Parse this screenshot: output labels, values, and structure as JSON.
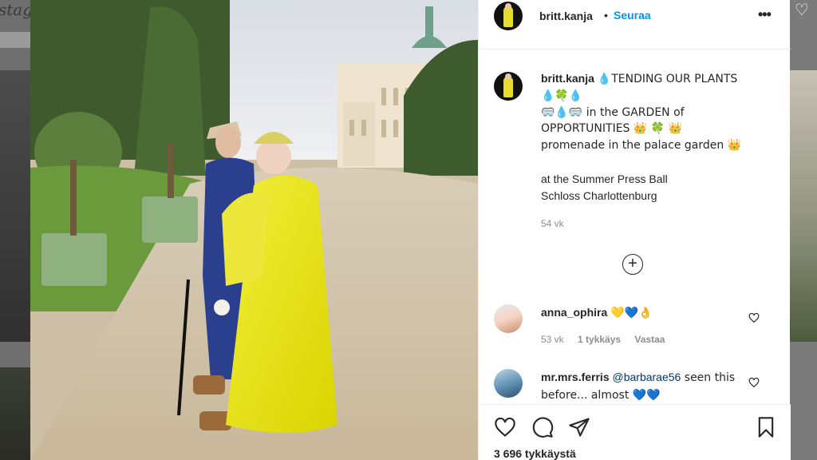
{
  "background": {
    "logo_fragment": "stagr"
  },
  "post": {
    "username": "britt.kanja",
    "dot": "•",
    "follow_label": "Seuraa",
    "more_icon": "more-horizontal-icon",
    "caption": {
      "line1": "💧TENDING OUR PLANTS",
      "line2": "💧🍀💧",
      "line3": "🥽💧🥽 in the GARDEN of",
      "line4": "OPPORTUNITIES 👑 🍀 👑",
      "line5": "promenade in the palace garden 👑",
      "line6": "",
      "line7": "at the Summer Press Ball",
      "line8": "Schloss Charlottenburg"
    },
    "caption_time": "54 vk",
    "load_more_icon": "plus-circle-icon",
    "comments": [
      {
        "username": "anna_ophira",
        "text": "💛💙👌",
        "time": "53 vk",
        "likes": "1 tykkäys",
        "reply": "Vastaa"
      },
      {
        "username": "mr.mrs.ferris",
        "mention": "@barbarae56",
        "text": " seen this before... almost 💙💙"
      }
    ],
    "likes_count": "3 696 tykkäystä"
  },
  "colors": {
    "follow_blue": "#0095f6",
    "text": "#262626",
    "secondary_text": "#8e8e8e",
    "dress_yellow": "#e9e60f"
  }
}
